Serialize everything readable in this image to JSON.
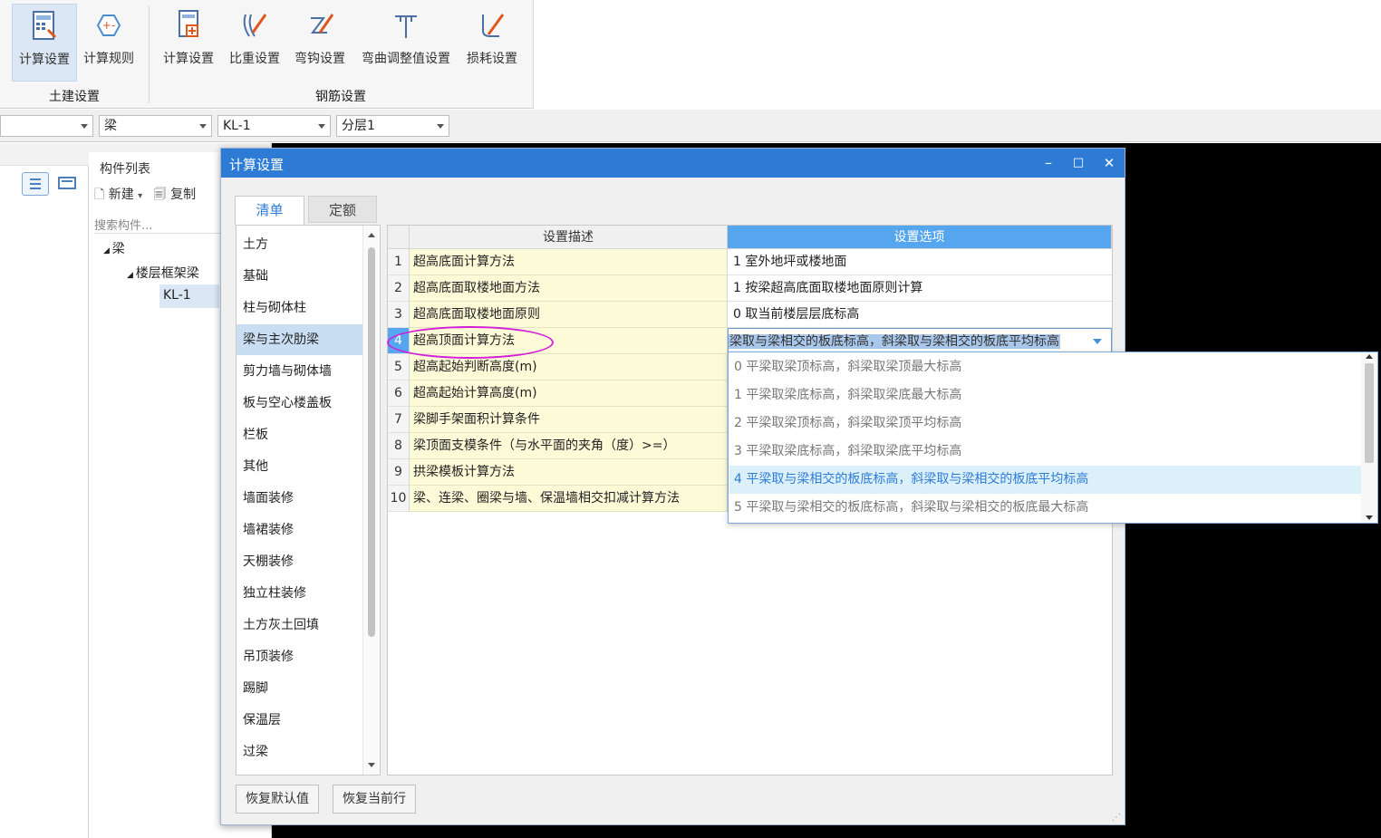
{
  "ribbon": {
    "buttons": [
      {
        "label": "计算设置",
        "icon": "calc-settings-icon"
      },
      {
        "label": "计算规则",
        "icon": "calc-rule-icon"
      },
      {
        "label": "计算设置",
        "icon": "rebar-calc-settings-icon"
      },
      {
        "label": "比重设置",
        "icon": "weight-icon"
      },
      {
        "label": "弯钩设置",
        "icon": "hook-icon"
      },
      {
        "label": "弯曲调整值设置",
        "icon": "bend-icon"
      },
      {
        "label": "损耗设置",
        "icon": "loss-icon"
      }
    ],
    "groups": [
      "土建设置",
      "钢筋设置"
    ]
  },
  "selectors": {
    "first": "",
    "type": "梁",
    "component": "KL-1",
    "layer": "分层1"
  },
  "component_panel": {
    "title": "构件列表",
    "new_label": "新建",
    "copy_label": "复制",
    "search_placeholder": "搜索构件...",
    "tree": {
      "root": "梁",
      "child": "楼层框架梁",
      "leaf": "KL-1"
    }
  },
  "dialog": {
    "title": "计算设置",
    "tabs": [
      "清单",
      "定额"
    ],
    "categories": [
      "土方",
      "基础",
      "柱与砌体柱",
      "梁与主次肋梁",
      "剪力墙与砌体墙",
      "板与空心楼盖板",
      "栏板",
      "其他",
      "墙面装修",
      "墙裙装修",
      "天棚装修",
      "独立柱装修",
      "土方灰土回填",
      "吊顶装修",
      "踢脚",
      "保温层",
      "过梁"
    ],
    "selected_category": "梁与主次肋梁",
    "grid_headers": {
      "desc": "设置描述",
      "option": "设置选项"
    },
    "rows": [
      {
        "n": "1",
        "desc": "超高底面计算方法",
        "opt": "1 室外地坪或楼地面"
      },
      {
        "n": "2",
        "desc": "超高底面取楼地面方法",
        "opt": "1 按梁超高底面取楼地面原则计算"
      },
      {
        "n": "3",
        "desc": "超高底面取楼地面原则",
        "opt": "0 取当前楼层层底标高"
      },
      {
        "n": "4",
        "desc": "超高顶面计算方法",
        "opt": "梁取与梁相交的板底标高，斜梁取与梁相交的板底平均标高"
      },
      {
        "n": "5",
        "desc": "超高起始判断高度(m)",
        "opt": ""
      },
      {
        "n": "6",
        "desc": "超高起始计算高度(m)",
        "opt": ""
      },
      {
        "n": "7",
        "desc": "梁脚手架面积计算条件",
        "opt": ""
      },
      {
        "n": "8",
        "desc": "梁顶面支模条件（与水平面的夹角（度）>=）",
        "opt": ""
      },
      {
        "n": "9",
        "desc": "拱梁模板计算方法",
        "opt": ""
      },
      {
        "n": "10",
        "desc": "梁、连梁、圈梁与墙、保温墙相交扣减计算方法",
        "opt": ""
      }
    ],
    "dropdown_options": [
      "0 平梁取梁顶标高，斜梁取梁顶最大标高",
      "1 平梁取梁底标高，斜梁取梁底最大标高",
      "2 平梁取梁顶标高，斜梁取梁顶平均标高",
      "3 平梁取梁底标高，斜梁取梁底平均标高",
      "4 平梁取与梁相交的板底标高，斜梁取与梁相交的板底平均标高",
      "5 平梁取与梁相交的板底标高，斜梁取与梁相交的板底最大标高"
    ],
    "buttons": {
      "restore_default": "恢复默认值",
      "restore_row": "恢复当前行"
    },
    "window": {
      "minimize": "–",
      "maximize": "□",
      "close": "✕"
    }
  },
  "colors": {
    "title_bar": "#2e7bd6",
    "header_option": "#55a6ef",
    "desc_cell": "#fdfbd7",
    "annotation_circle": "#d21fd8"
  }
}
